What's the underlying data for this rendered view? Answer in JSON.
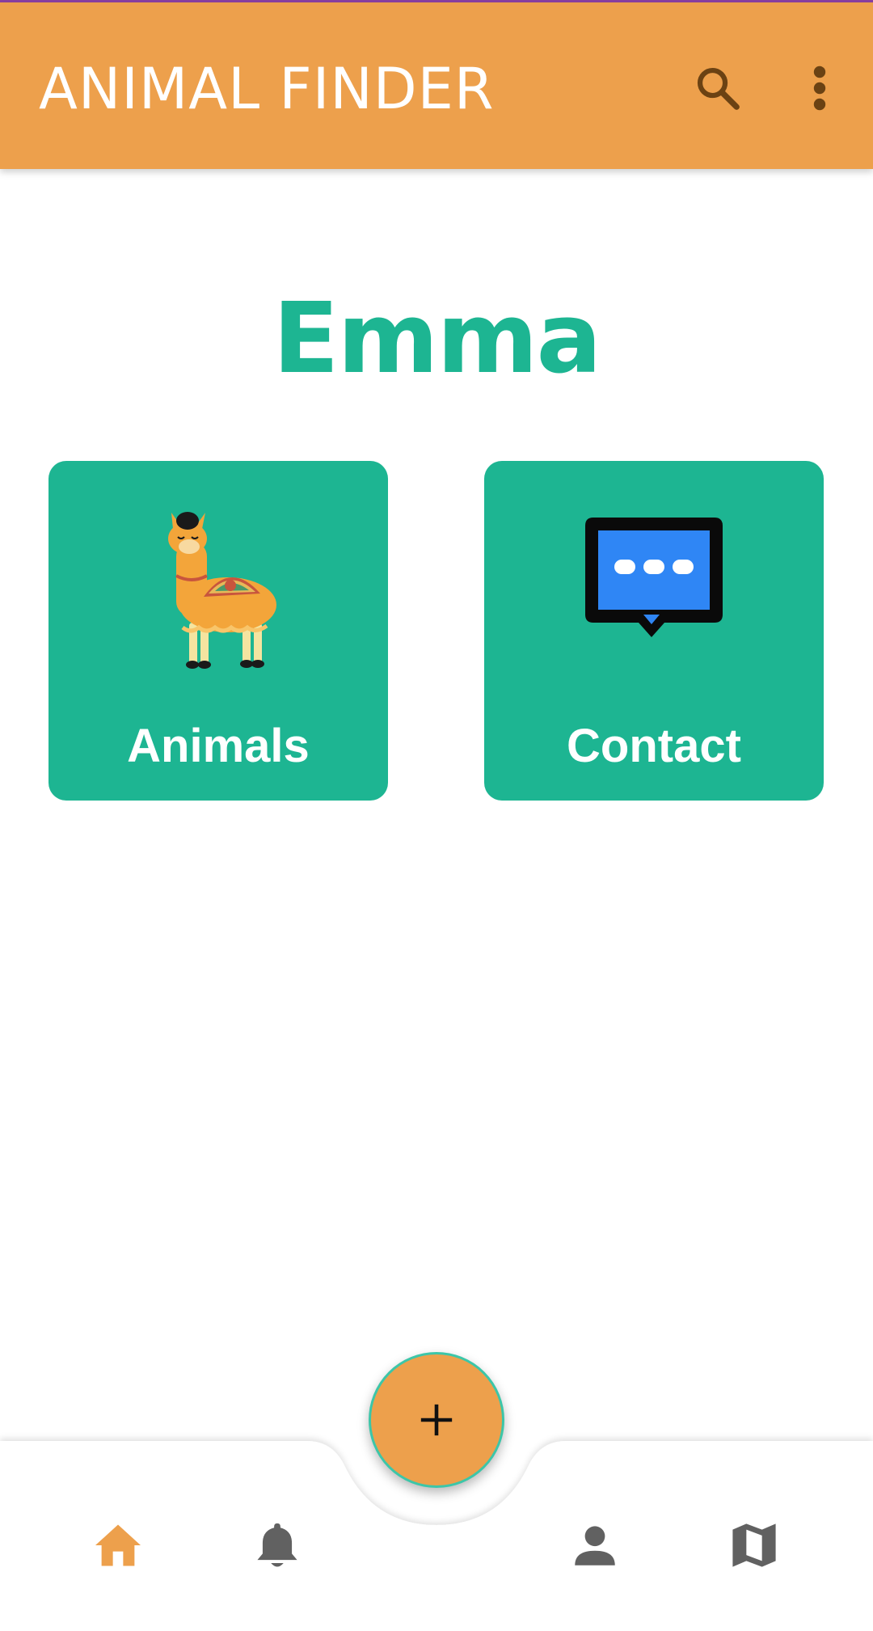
{
  "app_bar": {
    "title": "ANIMAL FINDER",
    "background_color": "#eda04c",
    "actions": [
      {
        "icon": "search-icon"
      },
      {
        "icon": "more-vert-icon"
      }
    ]
  },
  "greeting": {
    "name": "Emma",
    "color": "#1db592"
  },
  "cards": [
    {
      "label": "Animals",
      "icon": "llama-illustration",
      "color": "#1db592"
    },
    {
      "label": "Contact",
      "icon": "chat-bubble-icon",
      "color": "#1db592"
    }
  ],
  "fab": {
    "icon": "plus-icon",
    "color": "#eda04c"
  },
  "bottom_nav": {
    "items": [
      {
        "icon": "home-icon",
        "active": true,
        "color": "#eda04c"
      },
      {
        "icon": "bell-icon",
        "active": false,
        "color": "#616161"
      },
      {
        "icon": "person-icon",
        "active": false,
        "color": "#616161"
      },
      {
        "icon": "map-icon",
        "active": false,
        "color": "#616161"
      }
    ]
  }
}
